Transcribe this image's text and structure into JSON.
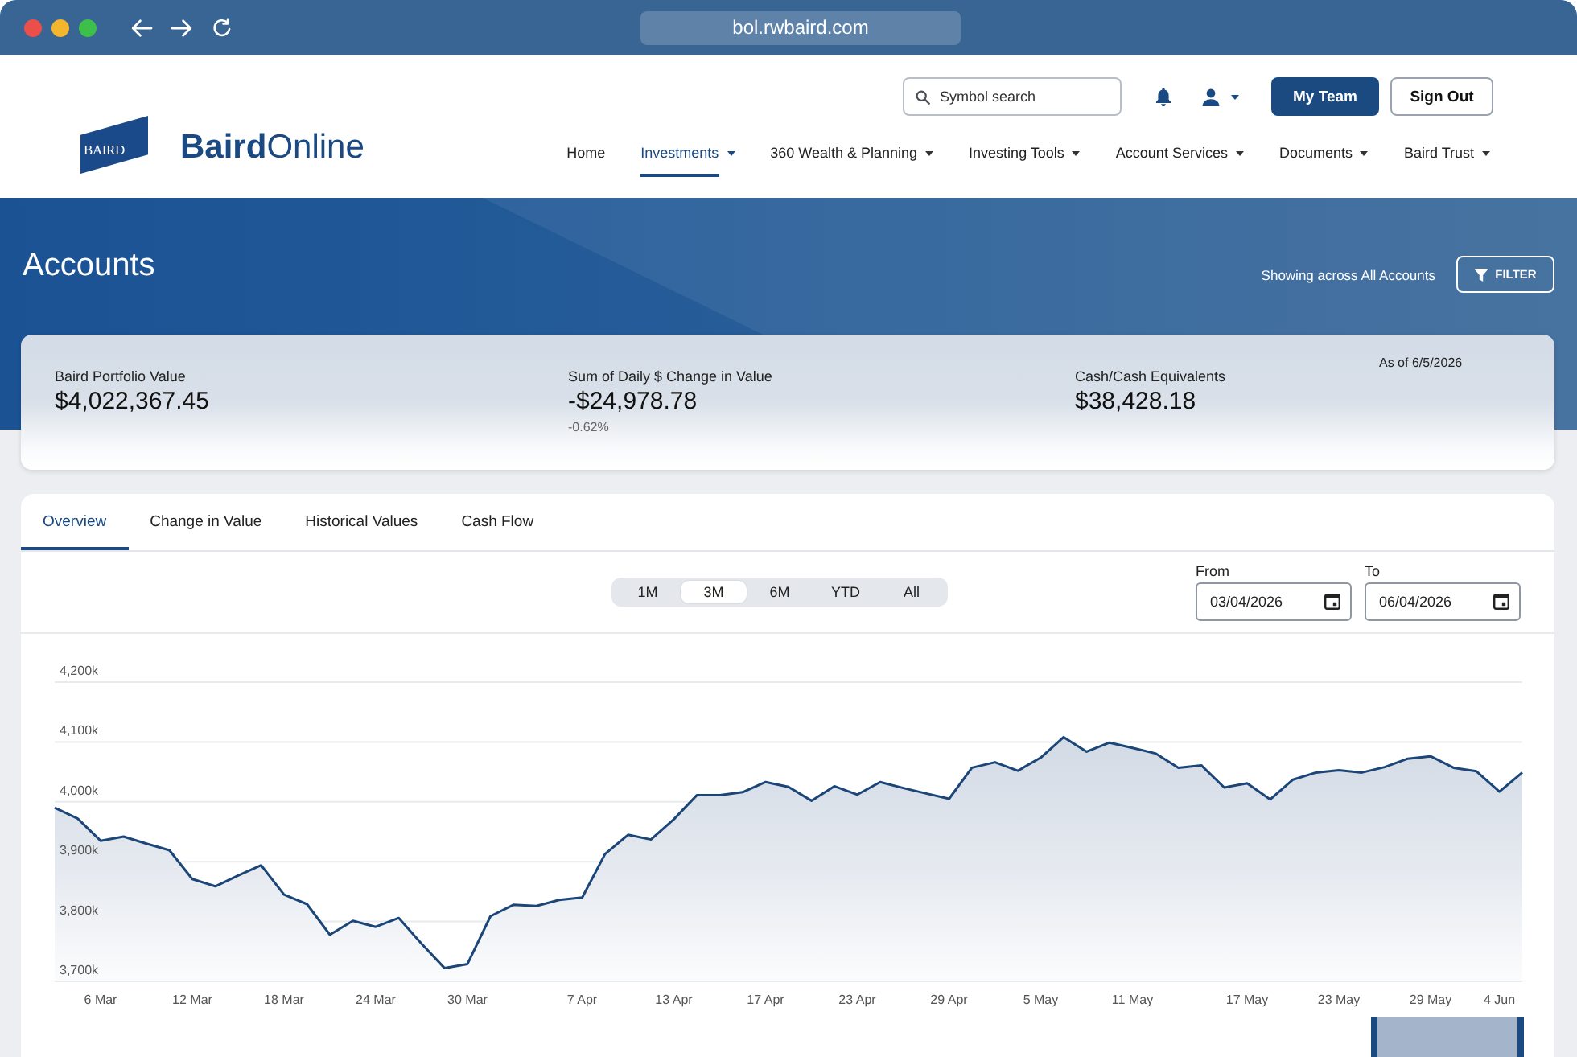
{
  "browser": {
    "url": "bol.rwbaird.com"
  },
  "header": {
    "logo_badge": "BAIRD",
    "brand": "**Baird**Online",
    "search": {
      "placeholder": "Symbol search"
    },
    "buttons": [
      {
        "label": "My Team",
        "kind": "primary"
      },
      {
        "label": "Sign Out",
        "kind": "secondary"
      }
    ],
    "nav": [
      {
        "label": "Home",
        "selected": false,
        "dropdown": false
      },
      {
        "label": "Investments",
        "selected": true,
        "dropdown": true
      },
      {
        "label": "360 Wealth & Planning",
        "selected": false,
        "dropdown": true
      },
      {
        "label": "Investing Tools",
        "selected": false,
        "dropdown": true
      },
      {
        "label": "Account Services",
        "selected": false,
        "dropdown": true
      },
      {
        "label": "Documents",
        "selected": false,
        "dropdown": true
      },
      {
        "label": "Baird Trust",
        "selected": false,
        "dropdown": true
      }
    ]
  },
  "banner": {
    "title": "Accounts",
    "scope": "Showing across All Accounts",
    "filter_button": "FILTER"
  },
  "summary": {
    "as_of": "As of 6/5/2026",
    "metrics": [
      {
        "label": "Baird Portfolio Value",
        "value": "$4,022,367.45"
      },
      {
        "label": "Sum of Daily $ Change in Value",
        "value": "-$24,978.78",
        "change": "-0.62%"
      },
      {
        "label": "Cash/Cash Equivalents",
        "value": "$38,428.18"
      }
    ]
  },
  "tabs": [
    {
      "label": "Overview",
      "selected": true
    },
    {
      "label": "Change in Value",
      "selected": false
    },
    {
      "label": "Historical Values",
      "selected": false
    },
    {
      "label": "Cash Flow",
      "selected": false
    }
  ],
  "ranges": [
    {
      "label": "1M",
      "selected": false
    },
    {
      "label": "3M",
      "selected": true
    },
    {
      "label": "6M",
      "selected": false
    },
    {
      "label": "YTD",
      "selected": false
    },
    {
      "label": "All",
      "selected": false
    }
  ],
  "date_range": {
    "fields": [
      {
        "label": "From",
        "value": "03/04/2026"
      },
      {
        "label": "To",
        "value": "06/04/2026"
      }
    ]
  },
  "chart": {
    "chart_data": {
      "type": "area",
      "grid": true,
      "ylim": [
        3700,
        4200
      ],
      "yticks": [
        {
          "value": 3700,
          "label": "3,700k"
        },
        {
          "value": 3800,
          "label": "3,800k"
        },
        {
          "value": 3900,
          "label": "3,900k"
        },
        {
          "value": 4000,
          "label": "4,000k"
        },
        {
          "value": 4100,
          "label": "4,100k"
        },
        {
          "value": 4200,
          "label": "4,200k"
        }
      ],
      "categories": [
        null,
        null,
        "6 Mar",
        null,
        null,
        null,
        "12 Mar",
        null,
        null,
        null,
        "18 Mar",
        null,
        null,
        null,
        "24 Mar",
        null,
        null,
        null,
        "30 Mar",
        null,
        null,
        null,
        null,
        "7 Apr",
        null,
        null,
        null,
        "13 Apr",
        null,
        null,
        null,
        "17 Apr",
        null,
        null,
        null,
        "23 Apr",
        null,
        null,
        null,
        "29 Apr",
        null,
        null,
        null,
        "5 May",
        null,
        null,
        null,
        "11 May",
        null,
        null,
        null,
        null,
        "17 May",
        null,
        null,
        null,
        "23 May",
        null,
        null,
        null,
        "29 May",
        null,
        null,
        "4 Jun",
        null
      ],
      "values": [
        3990,
        3972,
        3935,
        3942,
        3930,
        3919,
        3871,
        3859,
        3877,
        3894,
        3845,
        3829,
        3778,
        3801,
        3791,
        3806,
        3763,
        3722,
        3729,
        3809,
        3828,
        3826,
        3836,
        3840,
        3913,
        3945,
        3937,
        3971,
        4011,
        4011,
        4016,
        4033,
        4025,
        4002,
        4026,
        4012,
        4033,
        4023,
        4014,
        4005,
        4057,
        4066,
        4052,
        4074,
        4108,
        4084,
        4099,
        4090,
        4081,
        4057,
        4061,
        4024,
        4031,
        4004,
        4037,
        4049,
        4053,
        4049,
        4058,
        4072,
        4076,
        4057,
        4051,
        4017,
        4049
      ]
    }
  }
}
